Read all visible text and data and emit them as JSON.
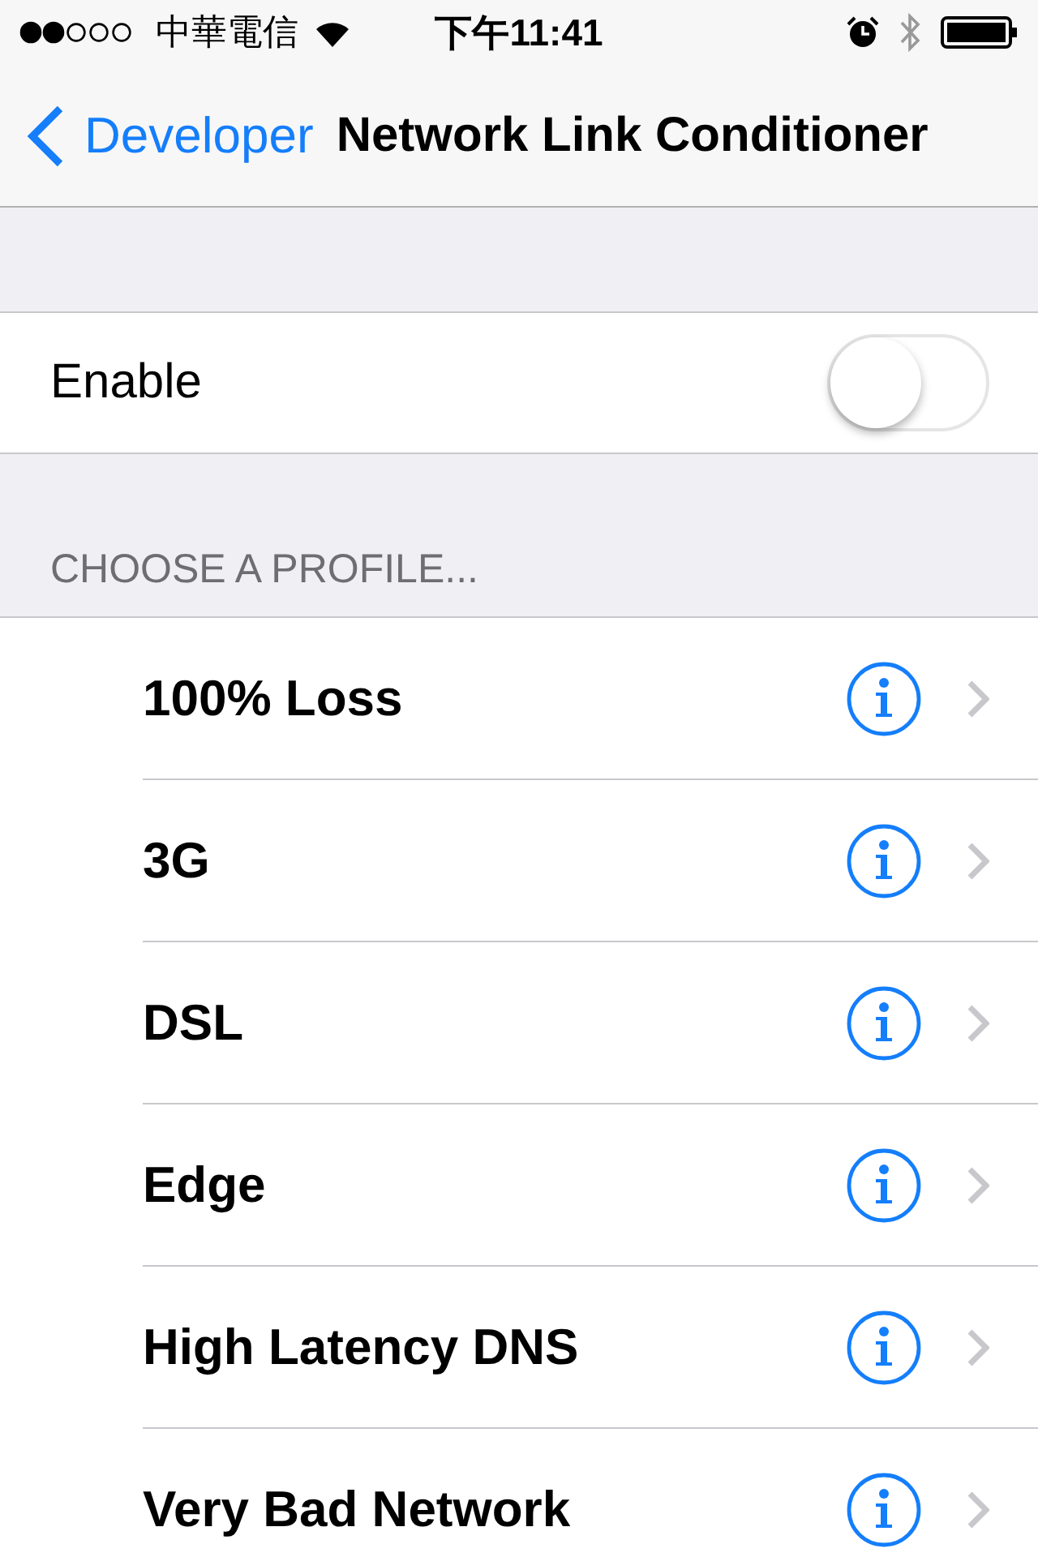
{
  "status_bar": {
    "carrier": "中華電信",
    "time": "下午11:41"
  },
  "nav": {
    "back": "Developer",
    "title": "Network Link Conditioner"
  },
  "enable": {
    "label": "Enable",
    "on": false
  },
  "section_header": "CHOOSE A PROFILE...",
  "profiles": [
    {
      "name": "100% Loss"
    },
    {
      "name": "3G"
    },
    {
      "name": "DSL"
    },
    {
      "name": "Edge"
    },
    {
      "name": "High Latency DNS"
    },
    {
      "name": "Very Bad Network"
    }
  ]
}
